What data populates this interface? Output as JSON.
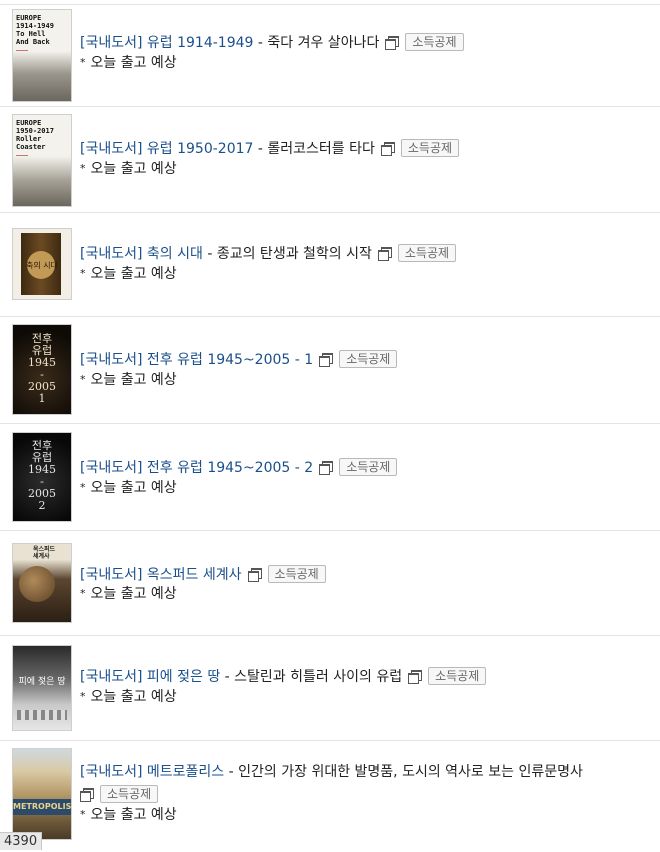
{
  "books": [
    {
      "category": "[국내도서]",
      "title": "유럽 1914-1949",
      "subtitle": "죽다 겨우 살아나다",
      "badge": "소득공제",
      "shipping": "오늘 출고 예상",
      "cover": {
        "text": "EUROPE\n1914-1949\nTo Hell\nAnd Back",
        "colors": [
          "#f4f2ec",
          "#7a7a72"
        ]
      }
    },
    {
      "category": "[국내도서]",
      "title": "유럽 1950-2017",
      "subtitle": "롤러코스터를 타다",
      "badge": "소득공제",
      "shipping": "오늘 출고 예상",
      "cover": {
        "text": "EUROPE\n1950-2017\nRoller\nCoaster",
        "colors": [
          "#f4f2ec",
          "#6f6f68"
        ]
      }
    },
    {
      "category": "[국내도서]",
      "title": "축의 시대",
      "subtitle": "종교의 탄생과 철학의 시작",
      "badge": "소득공제",
      "shipping": "오늘 출고 예상",
      "cover": {
        "text": "축의 시대",
        "colors": [
          "#f3efe6",
          "#5b3d18"
        ]
      }
    },
    {
      "category": "[국내도서]",
      "title": "전후 유럽 1945~2005 - 1",
      "subtitle": "",
      "badge": "소득공제",
      "shipping": "오늘 출고 예상",
      "cover": {
        "text": "전후\n유럽\n1945\n-\n2005\n1",
        "colors": [
          "#2a2016",
          "#120d08"
        ]
      }
    },
    {
      "category": "[국내도서]",
      "title": "전후 유럽 1945~2005 - 2",
      "subtitle": "",
      "badge": "소득공제",
      "shipping": "오늘 출고 예상",
      "cover": {
        "text": "전후\n유럽\n1945\n-\n2005\n2",
        "colors": [
          "#1d1d1d",
          "#0a0a0a"
        ]
      }
    },
    {
      "category": "[국내도서]",
      "title": "옥스퍼드 세계사",
      "subtitle": "",
      "badge": "소득공제",
      "shipping": "오늘 출고 예상",
      "cover": {
        "text": "옥스퍼드\n세계사",
        "colors": [
          "#e9e2d2",
          "#4a3524"
        ]
      }
    },
    {
      "category": "[국내도서]",
      "title": "피에 젖은 땅",
      "subtitle": "스탈린과 히틀러 사이의 유럽",
      "badge": "소득공제",
      "shipping": "오늘 출고 예상",
      "cover": {
        "text": "피에 젖은 땅",
        "colors": [
          "#5a5a5a",
          "#bdbdbd"
        ]
      }
    },
    {
      "category": "[국내도서]",
      "title": "메트로폴리스",
      "subtitle": "인간의 가장 위대한 발명품, 도시의 역사로 보는 인류문명사",
      "badge": "소득공제",
      "shipping": "오늘 출고 예상",
      "cover": {
        "text": "METROPOLIS",
        "colors": [
          "#d9c9a3",
          "#6e5a3a"
        ]
      }
    }
  ],
  "page_counter": "4390",
  "separator": " - ",
  "bullet": "*"
}
